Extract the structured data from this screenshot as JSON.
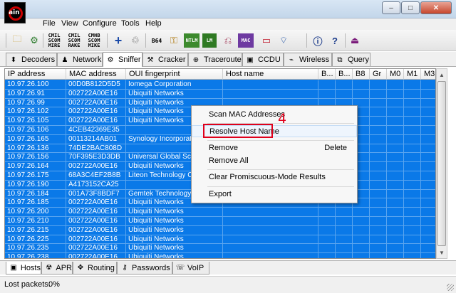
{
  "app": {
    "logo_text": "ain",
    "window_buttons": {
      "minimize": "–",
      "maximize": "□",
      "close": "✕"
    }
  },
  "menu": [
    "File",
    "View",
    "Configure",
    "Tools",
    "Help"
  ],
  "toolbar": {
    "icons": [
      "open-folder-icon",
      "start-sniffer-icon",
      "apr-cell-1-icon",
      "apr-cell-2-icon",
      "apr-cell-3-icon",
      "add-icon",
      "recycle-icon",
      "b64-icon",
      "certificate-icon",
      "ntlm-icon",
      "lm-icon",
      "route-icon",
      "mac-icon",
      "ccdu-icon",
      "wifi-icon",
      "about-icon",
      "help-icon",
      "stop-icon"
    ],
    "labels": {
      "cell1": "CMIL SCOM MIRE",
      "cell2": "CMIL SCOM RAKE",
      "cell3": "CMHB SCOM MIKE",
      "b64": "B64",
      "ntlm": "NTLM",
      "lm": "LM",
      "mac": "MAC"
    }
  },
  "top_tabs": [
    {
      "label": "Decoders",
      "icon": "decoder-icon"
    },
    {
      "label": "Network",
      "icon": "network-icon"
    },
    {
      "label": "Sniffer",
      "icon": "sniffer-icon"
    },
    {
      "label": "Cracker",
      "icon": "cracker-icon"
    },
    {
      "label": "Traceroute",
      "icon": "traceroute-icon"
    },
    {
      "label": "CCDU",
      "icon": "ccdu-icon"
    },
    {
      "label": "Wireless",
      "icon": "wireless-icon"
    },
    {
      "label": "Query",
      "icon": "query-icon"
    }
  ],
  "table": {
    "columns": [
      "IP address",
      "MAC address",
      "OUI fingerprint",
      "Host name",
      "B...",
      "B...",
      "B8",
      "Gr",
      "M0",
      "M1",
      "M3"
    ],
    "rows": [
      [
        "10.97.26.100",
        "00D0B812D5D5",
        "Iomega Corporation"
      ],
      [
        "10.97.26.91",
        "002722A00E16",
        "Ubiquiti Networks"
      ],
      [
        "10.97.26.99",
        "002722A00E16",
        "Ubiquiti Networks"
      ],
      [
        "10.97.26.102",
        "002722A00E16",
        "Ubiquiti Networks"
      ],
      [
        "10.97.26.105",
        "002722A00E16",
        "Ubiquiti Networks"
      ],
      [
        "10.97.26.106",
        "4CEB42369E35",
        ""
      ],
      [
        "10.97.26.165",
        "00113214AB01",
        "Synology Incorporated"
      ],
      [
        "10.97.26.136",
        "74DE2BAC808D",
        ""
      ],
      [
        "10.97.26.156",
        "70F395E3D3DB",
        "Universal Global Scie"
      ],
      [
        "10.97.26.164",
        "002722A00E16",
        "Ubiquiti Networks"
      ],
      [
        "10.97.26.175",
        "68A3C4EF2B8B",
        "Liteon Technology Co"
      ],
      [
        "10.97.26.190",
        "A4173152CA25",
        ""
      ],
      [
        "10.97.26.184",
        "001A73F8BDF7",
        "Gemtek Technology C"
      ],
      [
        "10.97.26.185",
        "002722A00E16",
        "Ubiquiti Networks"
      ],
      [
        "10.97.26.200",
        "002722A00E16",
        "Ubiquiti Networks"
      ],
      [
        "10.97.26.210",
        "002722A00E16",
        "Ubiquiti Networks"
      ],
      [
        "10.97.26.215",
        "002722A00E16",
        "Ubiquiti Networks"
      ],
      [
        "10.97.26.225",
        "002722A00E16",
        "Ubiquiti Networks"
      ],
      [
        "10.97.26.235",
        "002722A00E16",
        "Ubiquiti Networks"
      ],
      [
        "10.97.26.238",
        "002722A00E16",
        "Ubiquiti Networks"
      ]
    ]
  },
  "context_menu": {
    "scan": "Scan MAC Addresses",
    "resolve": "Resolve Host Name",
    "remove": "Remove",
    "remove_accel": "Delete",
    "remove_all": "Remove All",
    "clear": "Clear Promiscuous-Mode Results",
    "export": "Export"
  },
  "annotation": {
    "step": "4",
    "color": "#e0001b"
  },
  "bottom_tabs": [
    {
      "label": "Hosts",
      "icon": "hosts-icon"
    },
    {
      "label": "APR",
      "icon": "apr-icon"
    },
    {
      "label": "Routing",
      "icon": "routing-icon"
    },
    {
      "label": "Passwords",
      "icon": "passwords-icon"
    },
    {
      "label": "VoIP",
      "icon": "voip-icon"
    }
  ],
  "status": {
    "label": "Lost packets:",
    "value": "0%"
  },
  "colors": {
    "selection": "#0a79e8",
    "accent_red": "#e0001b"
  }
}
